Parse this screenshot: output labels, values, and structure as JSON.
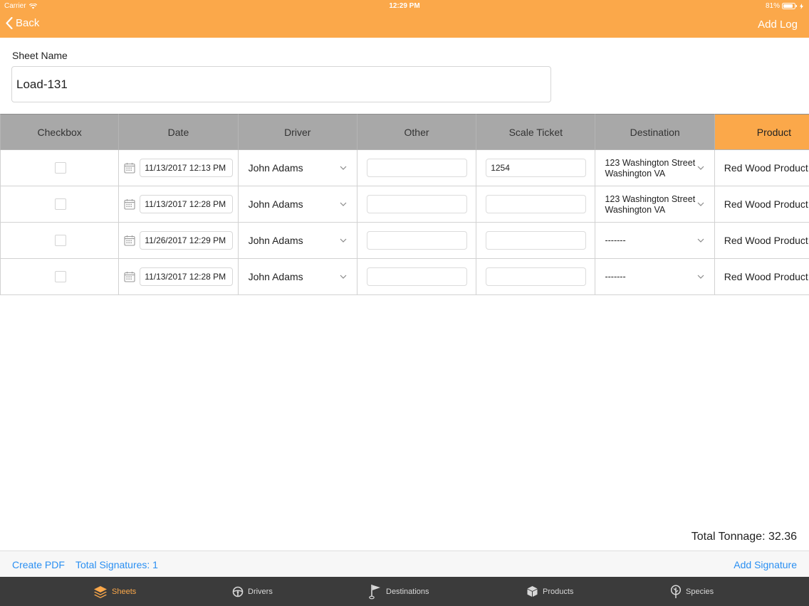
{
  "status_bar": {
    "carrier": "Carrier",
    "time": "12:29 PM",
    "battery": "81%"
  },
  "nav": {
    "back_label": "Back",
    "add_label": "Add Log"
  },
  "sheet": {
    "label": "Sheet Name",
    "value": "Load-131"
  },
  "table": {
    "headers": [
      "Checkbox",
      "Date",
      "Driver",
      "Other",
      "Scale Ticket",
      "Destination",
      "Product"
    ],
    "rows": [
      {
        "date": "11/13/2017 12:13 PM",
        "driver": "John Adams",
        "other": "",
        "scale_ticket": "1254",
        "destination": "123 Washington Street Washington VA",
        "product": "Red Wood Product"
      },
      {
        "date": "11/13/2017 12:28 PM",
        "driver": "John Adams",
        "other": "",
        "scale_ticket": "",
        "destination": "123 Washington Street Washington VA",
        "product": "Red Wood Product"
      },
      {
        "date": "11/26/2017 12:29 PM",
        "driver": "John Adams",
        "other": "",
        "scale_ticket": "",
        "destination": "-------",
        "product": "Red Wood Product"
      },
      {
        "date": "11/13/2017 12:28 PM",
        "driver": "John Adams",
        "other": "",
        "scale_ticket": "",
        "destination": "-------",
        "product": "Red Wood Product"
      }
    ]
  },
  "footer": {
    "total_tonnage": "Total Tonnage: 32.36",
    "create_pdf": "Create PDF",
    "total_signatures": "Total Signatures: 1",
    "add_signature": "Add Signature"
  },
  "tabs": [
    {
      "label": "Sheets",
      "icon": "layers-icon",
      "active": true
    },
    {
      "label": "Drivers",
      "icon": "steering-wheel-icon",
      "active": false
    },
    {
      "label": "Destinations",
      "icon": "flag-icon",
      "active": false
    },
    {
      "label": "Products",
      "icon": "box-icon",
      "active": false
    },
    {
      "label": "Species",
      "icon": "tree-icon",
      "active": false
    }
  ],
  "colors": {
    "accent": "#fba84a",
    "link": "#2a8ff2",
    "tabbar": "#3b3b3b",
    "header_gray": "#a8a8a8"
  }
}
